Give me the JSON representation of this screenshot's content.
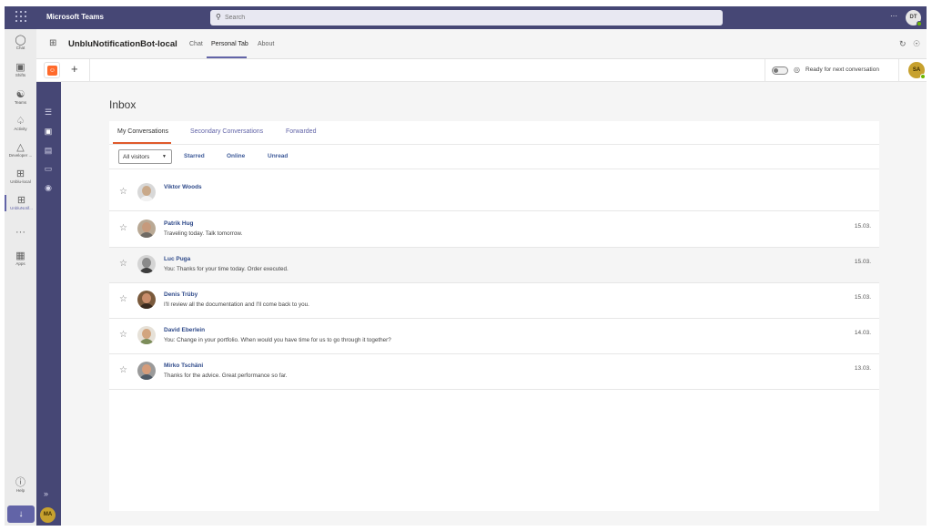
{
  "topbar": {
    "app_title": "Microsoft Teams",
    "search_placeholder": "Search",
    "more_label": "···",
    "user_initials": "DT"
  },
  "rail": {
    "items": [
      {
        "label": "Chat",
        "icon": "chat-icon"
      },
      {
        "label": "Shifts",
        "icon": "shifts-icon"
      },
      {
        "label": "Teams",
        "icon": "teams-icon"
      },
      {
        "label": "Activity",
        "icon": "bell-icon"
      },
      {
        "label": "Developer ...",
        "icon": "developer-icon"
      },
      {
        "label": "Unblu-local",
        "icon": "app-icon"
      },
      {
        "label": "UnbluNotif...",
        "icon": "app-icon"
      },
      {
        "label": "···",
        "icon": "more-icon"
      },
      {
        "label": "Apps",
        "icon": "apps-icon"
      }
    ],
    "help_label": "Help",
    "download_label": "↓"
  },
  "header": {
    "title": "UnbluNotificationBot-local",
    "tabs": [
      "Chat",
      "Personal Tab",
      "About"
    ],
    "active_tab": "Personal Tab"
  },
  "toolbar": {
    "add_label": "+",
    "ready_label": "Ready for next conversation",
    "agent_initials": "SA"
  },
  "appnav": {
    "user_initials": "MA"
  },
  "inbox": {
    "title": "Inbox",
    "tabs": [
      "My Conversations",
      "Secondary Conversations",
      "Forwarded"
    ],
    "filter_select": "All visitors",
    "filter_links": [
      "Starred",
      "Online",
      "Unread"
    ],
    "conversations": [
      {
        "name": "Viktor Woods",
        "message": "",
        "date": ""
      },
      {
        "name": "Patrik Hug",
        "message": "Traveling today. Talk tomorrow.",
        "date": "15.03."
      },
      {
        "name": "Luc Puga",
        "message": "You: Thanks for your time today. Order executed.",
        "date": "15.03."
      },
      {
        "name": "Denis Trüby",
        "message": "I'll review all the documentation and I'll come back to you.",
        "date": "15.03."
      },
      {
        "name": "David Eberlein",
        "message": "You: Change in your portfolio. When would you have time for us to go through it together?",
        "date": "14.03."
      },
      {
        "name": "Mirko Tschäni",
        "message": "Thanks for the advice. Great performance so far.",
        "date": "13.03."
      }
    ]
  },
  "colors": {
    "brand": "#464775",
    "accent": "#6264a7",
    "tab_underline": "#e05a2b",
    "presence": "#6bb700"
  }
}
